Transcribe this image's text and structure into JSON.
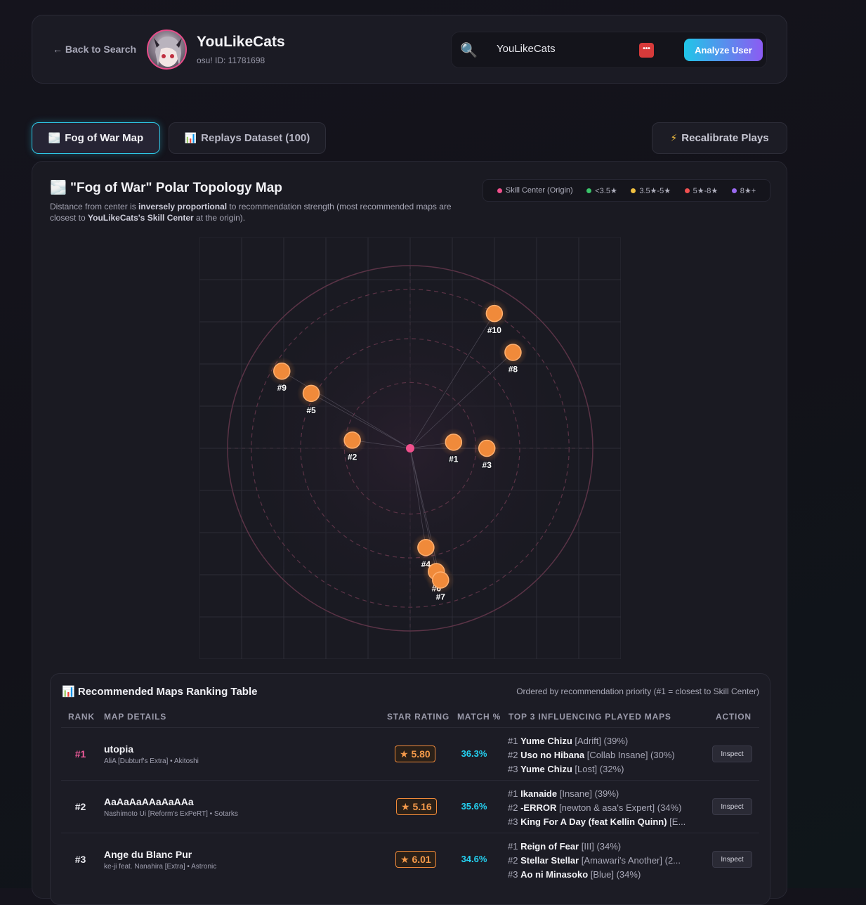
{
  "header": {
    "back_label": "← Back to Search",
    "user_name": "YouLikeCats",
    "user_id": "osu! ID: 11781698",
    "search_value": "YouLikeCats",
    "analyze_label": "Analyze User"
  },
  "tabs": {
    "fog": "Fog of War Map",
    "replays": "Replays Dataset (100)",
    "recalibrate": "Recalibrate Plays"
  },
  "map": {
    "title": "\"Fog of War\" Polar Topology Map",
    "desc_1": "Distance from center is ",
    "desc_bold_1": "inversely proportional",
    "desc_2": " to recommendation strength (most recommended maps are closest to ",
    "desc_bold_2": "YouLikeCats's Skill Center",
    "desc_3": " at the origin).",
    "legend": [
      {
        "label": "Skill Center (Origin)",
        "color": "#f0508c"
      },
      {
        "label": "<3.5★",
        "color": "#3ac46a"
      },
      {
        "label": "3.5★-5★",
        "color": "#f0c040"
      },
      {
        "label": "5★-8★",
        "color": "#f05050"
      },
      {
        "label": "8★+",
        "color": "#9a6af0"
      }
    ],
    "node_color": "#f08a3a",
    "center_color": "#f0508c",
    "nodes": [
      {
        "label": "#1",
        "r": 0.24,
        "angle_deg": 8
      },
      {
        "label": "#2",
        "r": 0.32,
        "angle_deg": 172
      },
      {
        "label": "#3",
        "r": 0.42,
        "angle_deg": 0
      },
      {
        "label": "#4",
        "r": 0.55,
        "angle_deg": 279
      },
      {
        "label": "#5",
        "r": 0.62,
        "angle_deg": 151
      },
      {
        "label": "#6",
        "r": 0.69,
        "angle_deg": 282
      },
      {
        "label": "#7",
        "r": 0.74,
        "angle_deg": 283
      },
      {
        "label": "#8",
        "r": 0.77,
        "angle_deg": 43
      },
      {
        "label": "#9",
        "r": 0.82,
        "angle_deg": 149
      },
      {
        "label": "#10",
        "r": 0.87,
        "angle_deg": 58
      }
    ]
  },
  "table": {
    "title": "Recommended Maps Ranking Table",
    "note": "Ordered by recommendation priority (#1 = closest to Skill Center)",
    "headers": {
      "rank": "RANK",
      "details": "MAP DETAILS",
      "star": "STAR RATING",
      "match": "MATCH %",
      "top3": "TOP 3 INFLUENCING PLAYED MAPS",
      "action": "ACTION"
    },
    "inspect_label": "Inspect",
    "rows": [
      {
        "rank": "#1",
        "name": "utopia",
        "sub": "AliA [Dubturf's Extra] • Akitoshi",
        "stars": "★ 5.80",
        "match": "36.3%",
        "infl": [
          {
            "n": "#1 ",
            "title": "Yume Chizu",
            "rest": " [Adrift] (39%)"
          },
          {
            "n": "#2 ",
            "title": "Uso no Hibana",
            "rest": " [Collab Insane] (30%)"
          },
          {
            "n": "#3 ",
            "title": "Yume Chizu",
            "rest": " [Lost] (32%)"
          }
        ]
      },
      {
        "rank": "#2",
        "name": "AaAaAaAAaAaAAa",
        "sub": "Nashimoto Ui [Reform's ExPeRT] • Sotarks",
        "stars": "★ 5.16",
        "match": "35.6%",
        "infl": [
          {
            "n": "#1 ",
            "title": "Ikanaide",
            "rest": " [Insane] (39%)"
          },
          {
            "n": "#2 ",
            "title": "-ERROR",
            "rest": " [newton & asa's Expert] (34%)"
          },
          {
            "n": "#3 ",
            "title": "King For A Day (feat Kellin Quinn)",
            "rest": " [E..."
          }
        ]
      },
      {
        "rank": "#3",
        "name": "Ange du Blanc Pur",
        "sub": "ke-ji feat. Nanahira [Extra] • Astronic",
        "stars": "★ 6.01",
        "match": "34.6%",
        "infl": [
          {
            "n": "#1 ",
            "title": "Reign of Fear",
            "rest": " [III] (34%)"
          },
          {
            "n": "#2 ",
            "title": "Stellar Stellar",
            "rest": " [Amawari's Another] (2..."
          },
          {
            "n": "#3 ",
            "title": "Ao ni Minasoko",
            "rest": " [Blue] (34%)"
          }
        ]
      }
    ]
  }
}
